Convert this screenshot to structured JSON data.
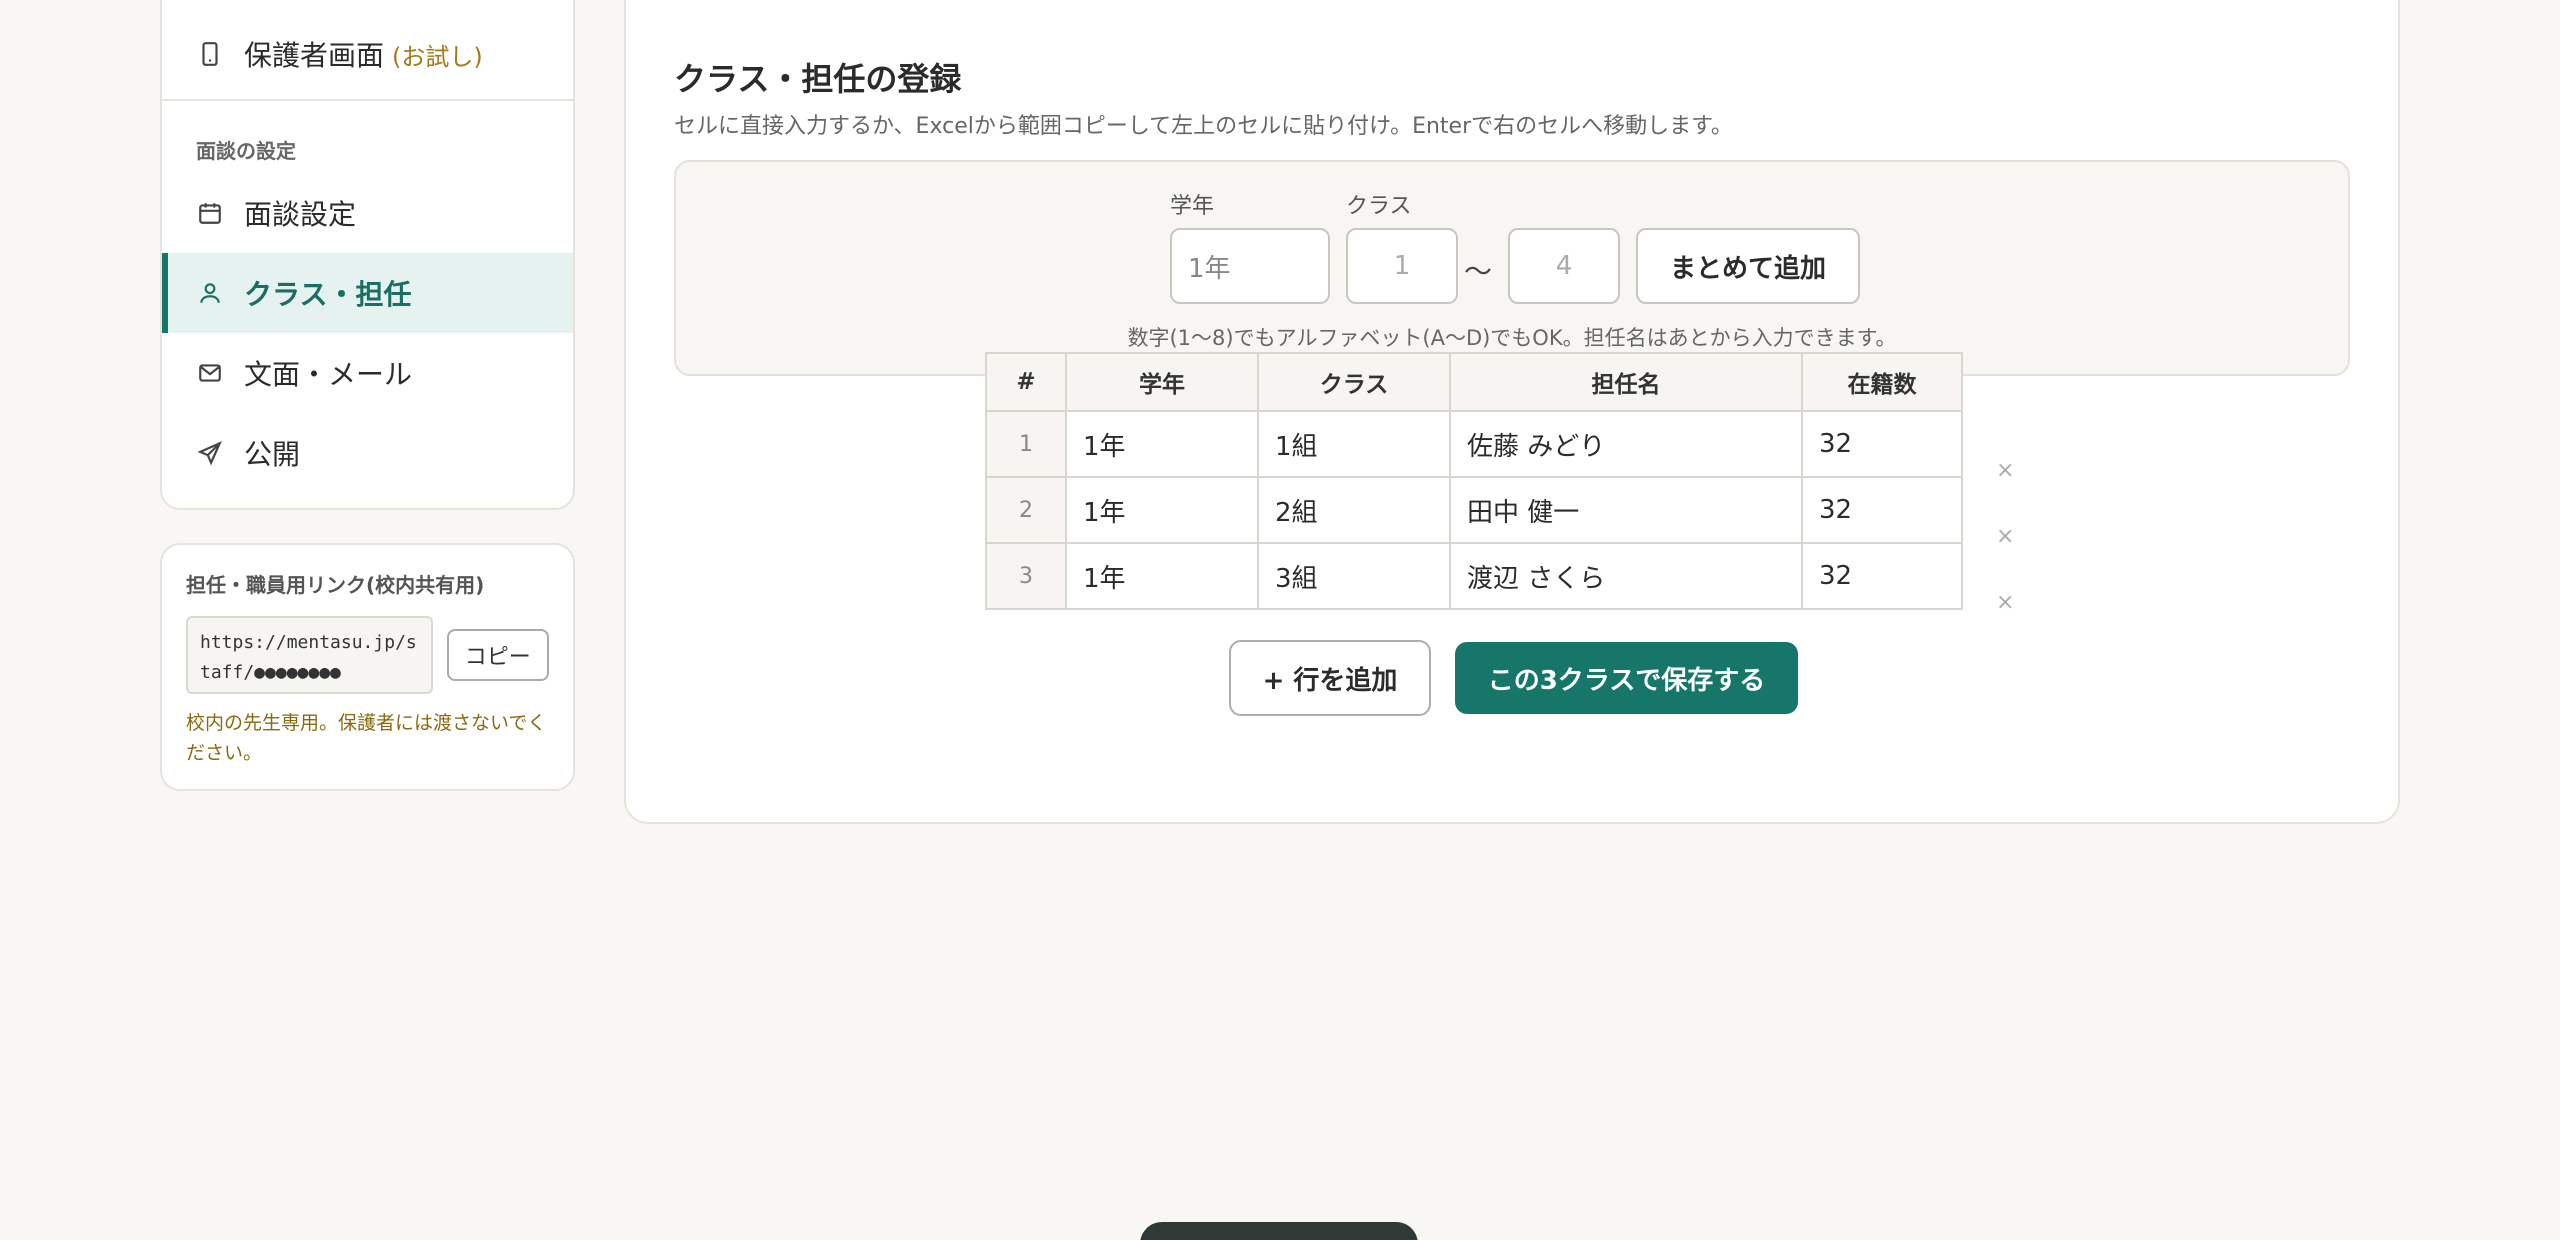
{
  "sidebar": {
    "parent_view": {
      "label": "保護者画面",
      "badge": "(お試し)"
    },
    "section_label": "面談の設定",
    "items": [
      {
        "label": "面談設定",
        "icon": "calendar-icon"
      },
      {
        "label": "クラス・担任",
        "icon": "user-icon",
        "active": true
      },
      {
        "label": "文面・メール",
        "icon": "mail-icon"
      },
      {
        "label": "公開",
        "icon": "send-icon"
      }
    ]
  },
  "staff_link": {
    "title": "担任・職員用リンク(校内共有用)",
    "url": "https://mentasu.jp/staff/●●●●●●●●",
    "copy_label": "コピー",
    "note": "校内の先生専用。保護者には渡さないでください。"
  },
  "main": {
    "title": "クラス・担任の登録",
    "description": "セルに直接入力するか、Excelから範囲コピーして左上のセルに貼り付け。Enterで右のセルへ移動します。",
    "bulk": {
      "grade_label": "学年",
      "class_label": "クラス",
      "grade_value": "1年",
      "from_placeholder": "1",
      "to_placeholder": "4",
      "tilde": "〜",
      "add_label": "まとめて追加",
      "hint": "数字(1〜8)でもアルファベット(A〜D)でもOK。担任名はあとから入力できます。"
    },
    "table": {
      "headers": [
        "#",
        "学年",
        "クラス",
        "担任名",
        "在籍数"
      ],
      "rows": [
        {
          "idx": "1",
          "grade": "1年",
          "class": "1組",
          "teacher": "佐藤 みどり",
          "count": "32"
        },
        {
          "idx": "2",
          "grade": "1年",
          "class": "2組",
          "teacher": "田中 健一",
          "count": "32"
        },
        {
          "idx": "3",
          "grade": "1年",
          "class": "3組",
          "teacher": "渡辺 さくら",
          "count": "32"
        }
      ],
      "delete_symbol": "×"
    },
    "add_row_label": "+ 行を追加",
    "save_label": "この3クラスで保存する"
  },
  "colors": {
    "accent": "#17766a",
    "active_bg": "#e6f2ef",
    "warning_text": "#8a6a10"
  }
}
